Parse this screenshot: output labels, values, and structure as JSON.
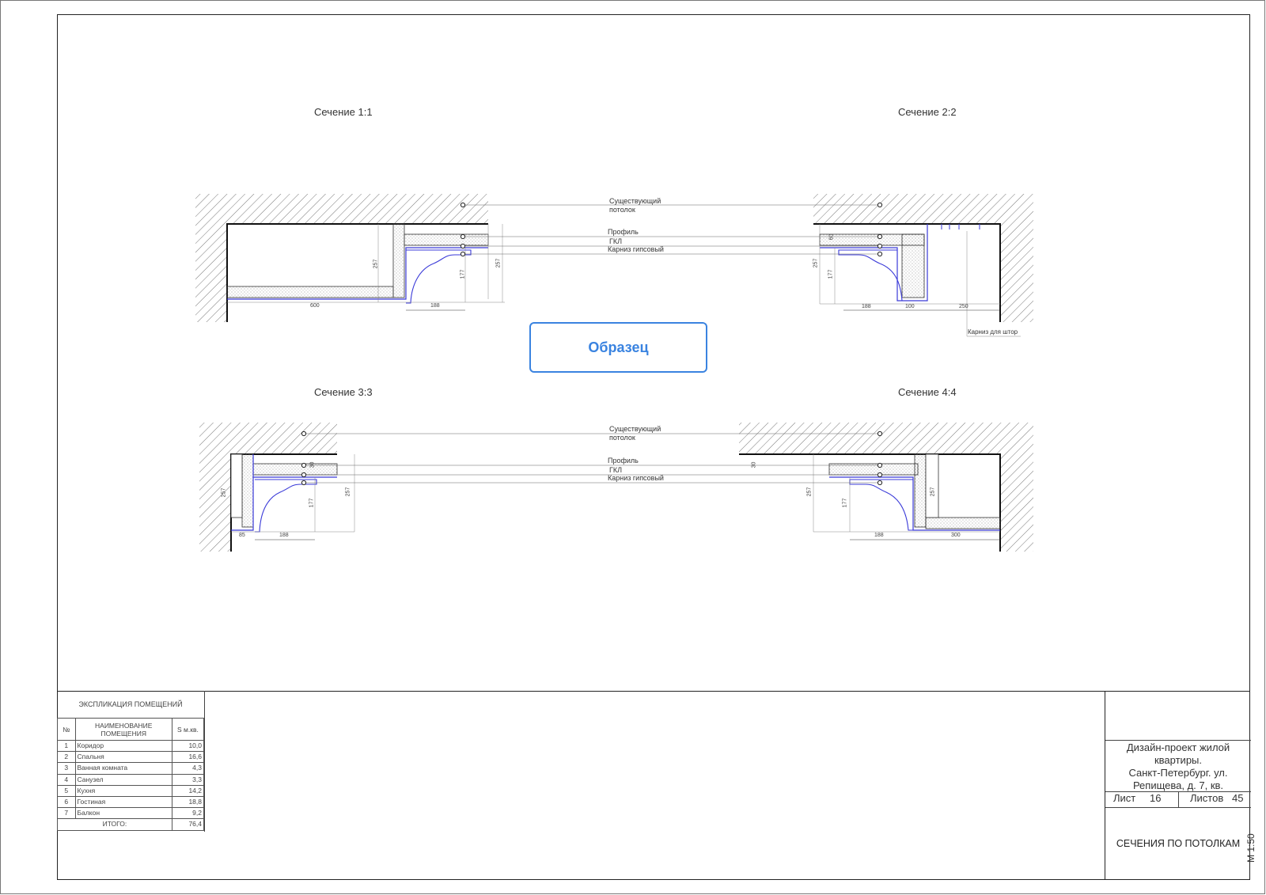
{
  "sections": {
    "s1_title": "Сечение 1:1",
    "s2_title": "Сечение 2:2",
    "s3_title": "Сечение 3:3",
    "s4_title": "Сечение 4:4"
  },
  "callouts_top": {
    "existing_ceiling_1": "Существующий",
    "existing_ceiling_2": "потолок",
    "profile": "Профиль",
    "gkl": "ГКЛ",
    "cornice": "Карниз гипсовый",
    "curtain_rail": "Карниз для штор"
  },
  "callouts_bottom": {
    "existing_ceiling_1": "Существующий",
    "existing_ceiling_2": "потолок",
    "profile": "Профиль",
    "gkl": "ГКЛ",
    "cornice": "Карниз гипсовый"
  },
  "dimensions": {
    "s1_600": "600",
    "s1_188": "188",
    "s1_257a": "257",
    "s1_177": "177",
    "s1_257b": "257",
    "s2_257": "257",
    "s2_60": "60",
    "s2_177": "177",
    "s2_188": "188",
    "s2_100": "100",
    "s2_250": "250",
    "s3_257a": "257",
    "s3_30": "30",
    "s3_177": "177",
    "s3_257b": "257",
    "s3_85": "85",
    "s3_188": "188",
    "s4_30": "30",
    "s4_257a": "257",
    "s4_177": "177",
    "s4_257b": "257",
    "s4_188": "188",
    "s4_300": "300"
  },
  "watermark": "Образец",
  "explication": {
    "title": "ЭКСПЛИКАЦИЯ ПОМЕЩЕНИЙ",
    "col_no": "№",
    "col_name_1": "НАИМЕНОВАНИЕ",
    "col_name_2": "ПОМЕЩЕНИЯ",
    "col_area": "S м.кв.",
    "rows": [
      {
        "no": "1",
        "name": "Коридор",
        "area": "10,0"
      },
      {
        "no": "2",
        "name": "Спальня",
        "area": "16,6"
      },
      {
        "no": "3",
        "name": "Ванная комната",
        "area": "4,3"
      },
      {
        "no": "4",
        "name": "Санузел",
        "area": "3,3"
      },
      {
        "no": "5",
        "name": "Кухня",
        "area": "14,2"
      },
      {
        "no": "6",
        "name": "Гостиная",
        "area": "18,8"
      },
      {
        "no": "7",
        "name": "Балкон",
        "area": "9,2"
      }
    ],
    "total_label": "ИТОГО:",
    "total_value": "76,4"
  },
  "stamp": {
    "project_1": "Дизайн-проект жилой",
    "project_2": "квартиры.",
    "project_3": "Санкт-Петербург. ул.",
    "project_4": "Репищева, д. 7, кв.",
    "sheet_label": "Лист",
    "sheet_value": "16",
    "sheets_label": "Листов",
    "sheets_value": "45",
    "sheet_name": "СЕЧЕНИЯ ПО ПОТОЛКАМ",
    "scale": "М 1:50"
  }
}
